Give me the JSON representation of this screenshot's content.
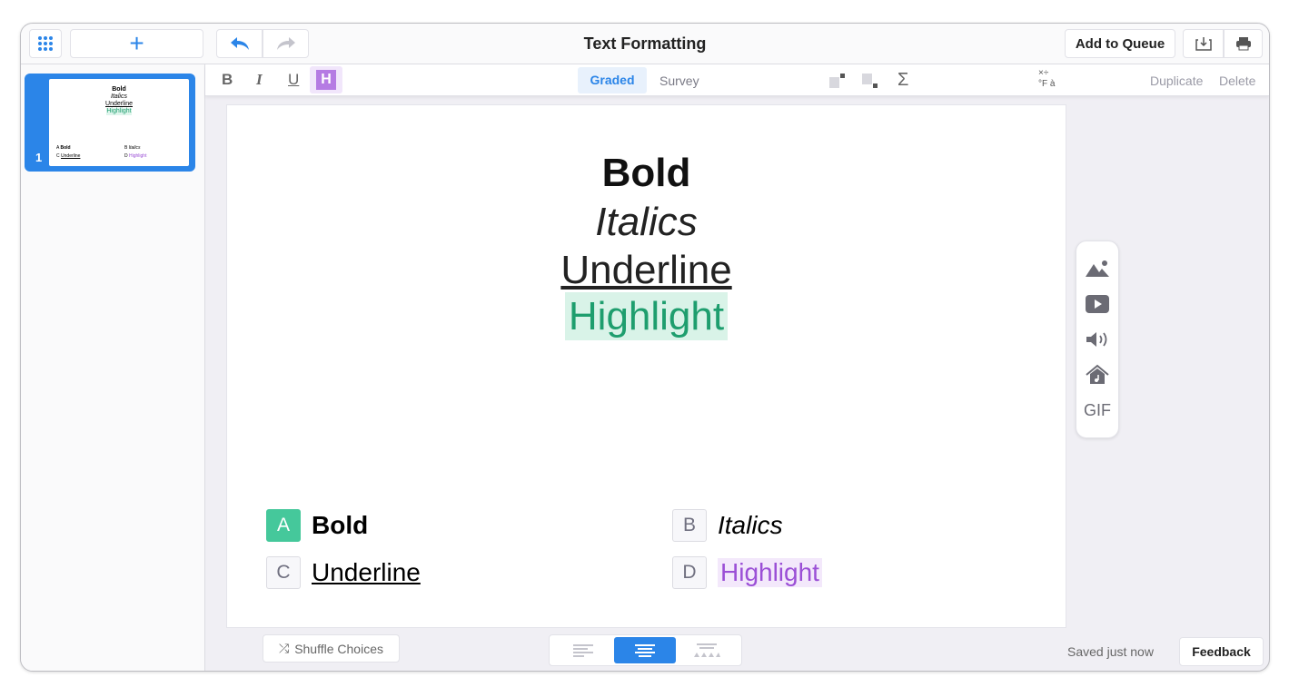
{
  "header": {
    "title": "Text Formatting",
    "add_to_queue": "Add to Queue"
  },
  "sidebar": {
    "slides": [
      {
        "number": "1",
        "title_lines": [
          "Bold",
          "Italics",
          "Underline",
          "Highlight"
        ],
        "choices": [
          {
            "letter": "A",
            "text": "Bold"
          },
          {
            "letter": "B",
            "text": "Italics"
          },
          {
            "letter": "C",
            "text": "Underline"
          },
          {
            "letter": "D",
            "text": "Highlight"
          }
        ]
      }
    ]
  },
  "toolbar": {
    "bold": "B",
    "italic": "I",
    "underline": "U",
    "highlight": "H",
    "graded": "Graded",
    "survey": "Survey",
    "duplicate": "Duplicate",
    "delete": "Delete",
    "sigma": "Σ"
  },
  "slide": {
    "lines": [
      "Bold",
      "Italics",
      "Underline",
      "Highlight"
    ],
    "choices": [
      {
        "letter": "A",
        "text": "Bold",
        "correct": true
      },
      {
        "letter": "B",
        "text": "Italics"
      },
      {
        "letter": "C",
        "text": "Underline"
      },
      {
        "letter": "D",
        "text": "Highlight"
      }
    ]
  },
  "media": {
    "gif": "GIF"
  },
  "footer": {
    "shuffle": "Shuffle Choices",
    "saved": "Saved just now",
    "feedback": "Feedback"
  },
  "colors": {
    "accent": "#2b85e8",
    "correct": "#45c89b",
    "highlight_green": "#1e9e6e",
    "highlight_purple": "#9b4fd6"
  }
}
